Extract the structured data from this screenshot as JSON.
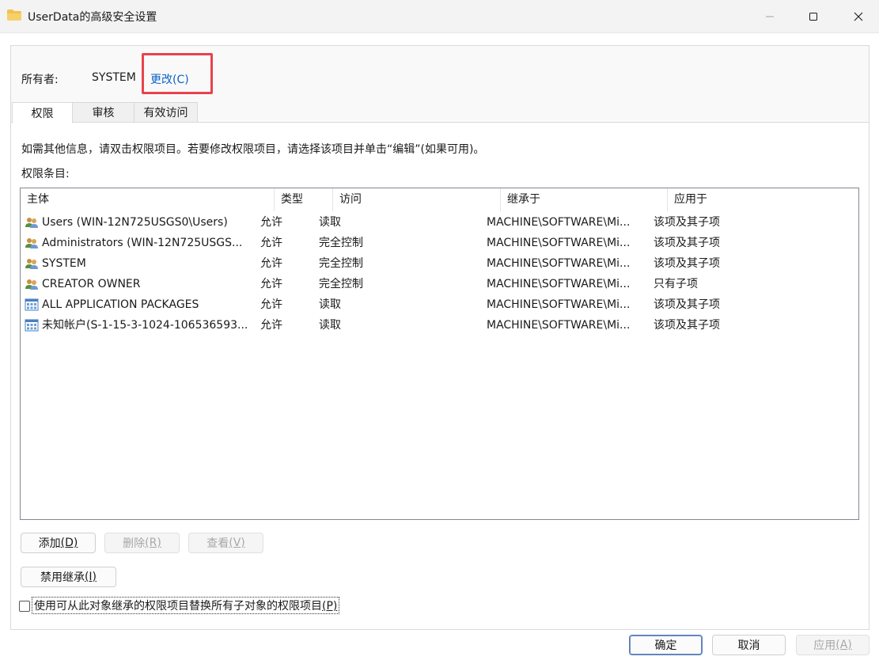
{
  "window": {
    "title": "UserData的高级安全设置",
    "controls": {
      "minimize": "—",
      "maximize": "☐",
      "close": "✕"
    }
  },
  "owner": {
    "label": "所有者:",
    "value": "SYSTEM",
    "change_link": "更改(C)"
  },
  "tabs": [
    {
      "label": "权限",
      "active": true
    },
    {
      "label": "审核",
      "active": false
    },
    {
      "label": "有效访问",
      "active": false
    }
  ],
  "info_text": "如需其他信息，请双击权限项目。若要修改权限项目，请选择该项目并单击“编辑”(如果可用)。",
  "entries_label": "权限条目:",
  "table": {
    "columns": [
      "主体",
      "类型",
      "访问",
      "继承于",
      "应用于"
    ],
    "rows": [
      {
        "icon": "users-group-icon",
        "principal": "Users (WIN-12N725USGS0\\Users)",
        "type": "允许",
        "access": "读取",
        "inherited_from": "MACHINE\\SOFTWARE\\Mi...",
        "applies_to": "该项及其子项"
      },
      {
        "icon": "users-group-icon",
        "principal": "Administrators (WIN-12N725USGS...",
        "type": "允许",
        "access": "完全控制",
        "inherited_from": "MACHINE\\SOFTWARE\\Mi...",
        "applies_to": "该项及其子项"
      },
      {
        "icon": "users-group-icon",
        "principal": "SYSTEM",
        "type": "允许",
        "access": "完全控制",
        "inherited_from": "MACHINE\\SOFTWARE\\Mi...",
        "applies_to": "该项及其子项"
      },
      {
        "icon": "users-group-icon",
        "principal": "CREATOR OWNER",
        "type": "允许",
        "access": "完全控制",
        "inherited_from": "MACHINE\\SOFTWARE\\Mi...",
        "applies_to": "只有子项"
      },
      {
        "icon": "package-icon",
        "principal": "ALL APPLICATION PACKAGES",
        "type": "允许",
        "access": "读取",
        "inherited_from": "MACHINE\\SOFTWARE\\Mi...",
        "applies_to": "该项及其子项"
      },
      {
        "icon": "package-icon",
        "principal": "未知帐户(S-1-15-3-1024-106536593...",
        "type": "允许",
        "access": "读取",
        "inherited_from": "MACHINE\\SOFTWARE\\Mi...",
        "applies_to": "该项及其子项"
      }
    ]
  },
  "buttons": {
    "add": {
      "text": "添加",
      "key": "(D)"
    },
    "delete": {
      "text": "删除",
      "key": "(R)"
    },
    "view": {
      "text": "查看",
      "key": "(V)"
    },
    "disable_inheritance": {
      "text": "禁用继承",
      "key": "(I)"
    },
    "ok": "确定",
    "cancel": "取消",
    "apply": {
      "text": "应用",
      "key": "(A)"
    }
  },
  "replace_checkbox": {
    "label": "使用可从此对象继承的权限项目替换所有子对象的权限项目",
    "key": "(P)",
    "checked": false
  },
  "colors": {
    "link": "#0a62c9",
    "highlight_border": "#e8434d",
    "folder": "#f2c14e"
  }
}
